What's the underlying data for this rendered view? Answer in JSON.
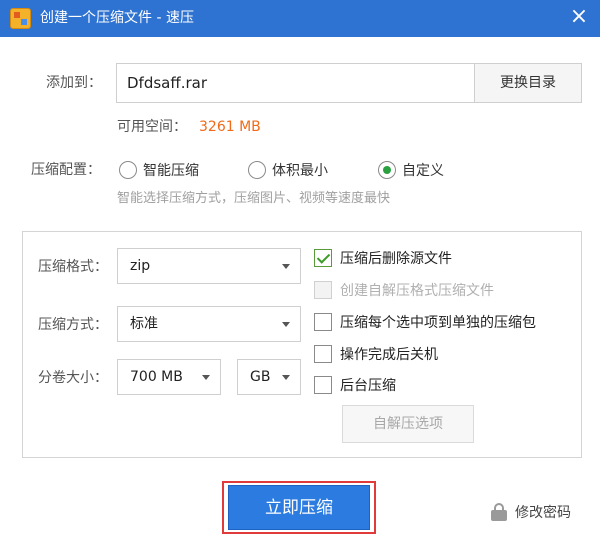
{
  "window": {
    "title": "创建一个压缩文件 - 速压",
    "close_glyph": "×"
  },
  "destination": {
    "label": "添加到：",
    "value": "Dfdsaff.rar",
    "browse_label": "更换目录",
    "space_label": "可用空间：",
    "space_value": "3261 MB"
  },
  "profile": {
    "label": "压缩配置：",
    "options": [
      {
        "label": "智能压缩",
        "selected": false
      },
      {
        "label": "体积最小",
        "selected": false
      },
      {
        "label": "自定义",
        "selected": true
      }
    ],
    "hint": "智能选择压缩方式，压缩图片、视频等速度最快"
  },
  "settings": {
    "format_label": "压缩格式：",
    "format_value": "zip",
    "method_label": "压缩方式：",
    "method_value": "标准",
    "volume_label": "分卷大小：",
    "volume_size": "700 MB",
    "volume_unit": "GB"
  },
  "options": [
    {
      "label": "压缩后删除源文件",
      "checked": true,
      "disabled": false
    },
    {
      "label": "创建自解压格式压缩文件",
      "checked": false,
      "disabled": true
    },
    {
      "label": "压缩每个选中项到单独的压缩包",
      "checked": false,
      "disabled": false
    },
    {
      "label": "操作完成后关机",
      "checked": false,
      "disabled": false
    },
    {
      "label": "后台压缩",
      "checked": false,
      "disabled": false
    }
  ],
  "sfx_button": "自解压选项",
  "compress_button": "立即压缩",
  "password_label": "修改密码",
  "colors": {
    "titlebar": "#2f73d2",
    "accent": "#2b7be0",
    "highlight_border": "#e03a3a",
    "space_value": "#f06a1a",
    "radio_on": "#2aa040"
  }
}
